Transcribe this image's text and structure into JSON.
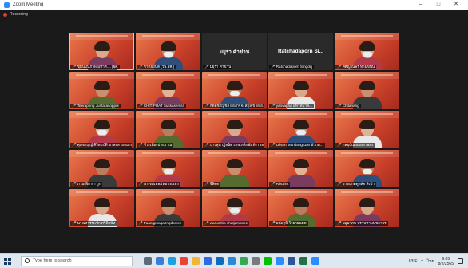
{
  "window": {
    "title": "Zoom Meeting",
    "controls": [
      "–",
      "□",
      "✕"
    ]
  },
  "meeting": {
    "recording_label": "Recording",
    "tiles": [
      {
        "style": "orange",
        "speaking": true,
        "name": "ชุมนิมนุภาพ มหาศ.... (ผศ.",
        "muted": true
      },
      {
        "style": "orange",
        "speaking": false,
        "name": "ชาติยยนต์ (วพ.สค.)",
        "muted": true
      },
      {
        "style": "dark",
        "speaking": false,
        "name": "มยุรา คำข่าน",
        "center": "มยุรา คำข่าน",
        "muted": true
      },
      {
        "style": "dark",
        "speaking": false,
        "name": "Ratchadaporn Singdej",
        "center": "Ratchadaporn Si...",
        "muted": true
      },
      {
        "style": "orange",
        "speaking": false,
        "name": "ศศิญานพร ทามขนิน",
        "muted": true
      },
      {
        "style": "orange",
        "speaking": false,
        "name": "Teerapong Juntarasoppol",
        "muted": true
      },
      {
        "style": "orange",
        "speaking": false,
        "name": "CHITIPHAT Sukkasemsri",
        "muted": true
      },
      {
        "style": "orange",
        "speaking": false,
        "name": "กิตติชาญชล ผ่องกิจจะสกุล ขาล.อ.ล...",
        "muted": true
      },
      {
        "style": "orange",
        "speaking": false,
        "name": "yaovapha แท่วหมาลั...",
        "muted": true
      },
      {
        "style": "orange",
        "speaking": false,
        "name": "Chitanang",
        "muted": true
      },
      {
        "style": "orange",
        "speaking": false,
        "name": "ศุภชาญญ์ ศิริสมบัติ ขาละลายหมาบ...",
        "muted": true
      },
      {
        "style": "orange",
        "speaking": false,
        "name": "ชีวะเพียงประมาณ",
        "muted": true
      },
      {
        "style": "orange",
        "speaking": false,
        "name": "นางสุนาฏิลนิต เทพเหล็กพัมท์งานจา",
        "muted": true
      },
      {
        "style": "orange",
        "speaking": false,
        "name": "Ulivan Mandang และ ผัวกม...",
        "muted": true
      },
      {
        "style": "orange",
        "speaking": false,
        "name": "กลยุบัณ ผมผลาพละ",
        "muted": true
      },
      {
        "style": "orange",
        "speaking": false,
        "name": "ภามเพ็ก หา ถูก",
        "muted": true
      },
      {
        "style": "orange",
        "speaking": false,
        "name": "นาเจทเทพม่ทธรรณพร",
        "muted": true
      },
      {
        "style": "orange",
        "speaking": false,
        "name": "จีลิดด",
        "muted": true
      },
      {
        "style": "orange",
        "speaking": false,
        "name": "Rikurint",
        "muted": true
      },
      {
        "style": "orange",
        "speaking": false,
        "name": "อาจนกดดูพลัจ สิ่งบ้า",
        "muted": true
      },
      {
        "style": "orange",
        "speaking": false,
        "name": "นางเทวรรพชัก ศรีลิมพัท",
        "muted": true
      },
      {
        "style": "orange",
        "speaking": false,
        "name": "Puangphaga Ingdamee",
        "muted": true
      },
      {
        "style": "orange",
        "speaking": false,
        "name": "warunthip chatjamanee",
        "muted": true
      },
      {
        "style": "orange",
        "speaking": false,
        "name": "ธนัลฤพิ ใจยายนมต",
        "muted": true
      },
      {
        "style": "orange",
        "speaking": false,
        "name": "ผมูมาภพ ปราบหามนุชลาวร",
        "muted": true
      }
    ]
  },
  "taskbar": {
    "search_placeholder": "Type here to search",
    "apps": [
      {
        "icon": "task-view-icon",
        "color": "#5a6b7d"
      },
      {
        "icon": "widgets-icon",
        "color": "#3b7dd8"
      },
      {
        "icon": "edge-icon",
        "color": "#1ba1e2"
      },
      {
        "icon": "chrome-icon",
        "color": "#ea4335"
      },
      {
        "icon": "file-explorer-icon",
        "color": "#f2b636"
      },
      {
        "icon": "store-icon",
        "color": "#2d6cdf"
      },
      {
        "icon": "mail-icon",
        "color": "#0f6cbd"
      },
      {
        "icon": "photos-icon",
        "color": "#2b88d8"
      },
      {
        "icon": "chrome-icon",
        "color": "#34a853"
      },
      {
        "icon": "settings-icon",
        "color": "#7a7a7a"
      },
      {
        "icon": "line-icon",
        "color": "#00c300"
      },
      {
        "icon": "zoom-icon",
        "color": "#2d8cff"
      },
      {
        "icon": "word-icon",
        "color": "#2b579a"
      },
      {
        "icon": "excel-icon",
        "color": "#217346"
      },
      {
        "icon": "zoom-app-icon",
        "color": "#2d8cff"
      }
    ],
    "temperature": "83°F",
    "language": "ไทย",
    "time": "9:05",
    "date": "8/2/2565"
  }
}
